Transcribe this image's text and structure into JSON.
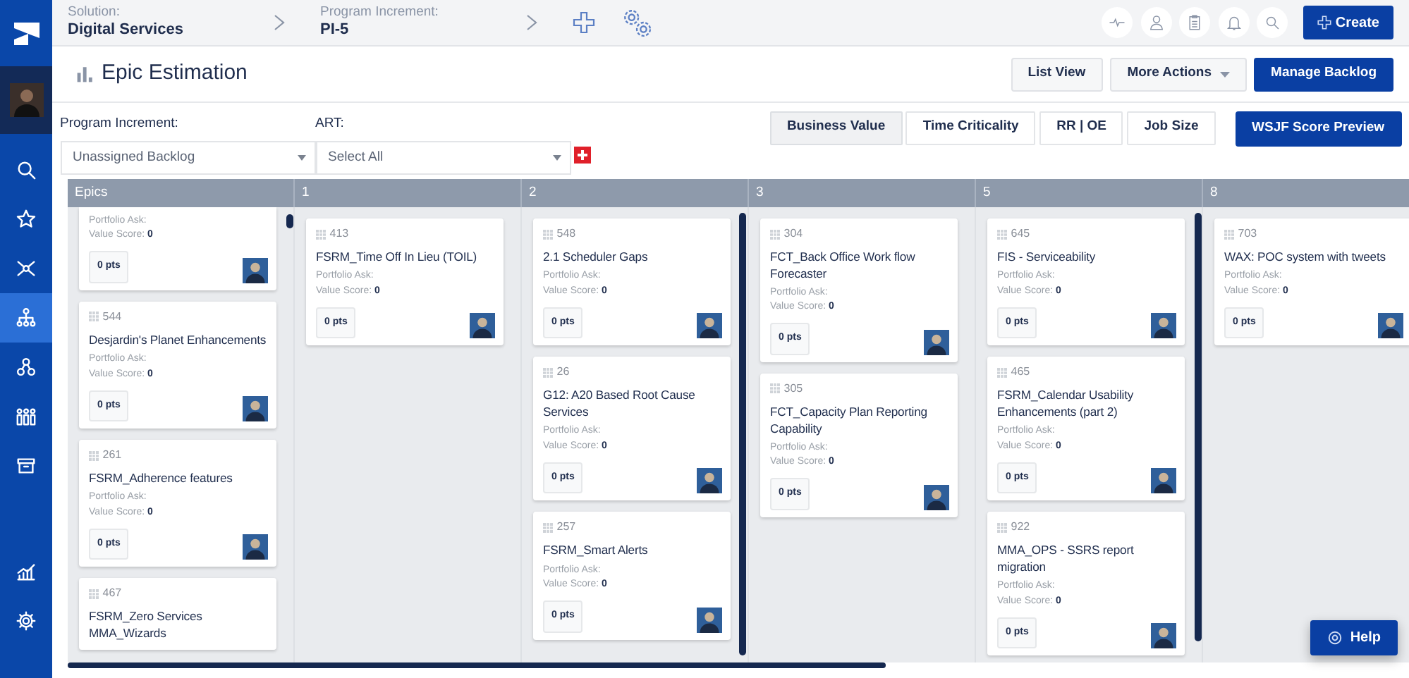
{
  "sidebar": {
    "items": [
      {
        "selected": false
      },
      {
        "selected": false
      },
      {
        "selected": false
      },
      {
        "selected": true
      },
      {
        "selected": false
      },
      {
        "selected": false
      },
      {
        "selected": false
      }
    ],
    "bottom_items": [
      {
        "selected": false
      },
      {
        "selected": false
      }
    ]
  },
  "topbar": {
    "breadcrumbs": [
      {
        "label": "Solution:",
        "value": "Digital Services"
      },
      {
        "label": "Program Increment:",
        "value": "PI-5"
      }
    ],
    "create_button": "Create"
  },
  "page_title": "Epic Estimation",
  "header_buttons": [
    {
      "label": "List View",
      "kind": "default"
    },
    {
      "label": "More Actions",
      "kind": "dropdown"
    },
    {
      "label": "Manage Backlog",
      "kind": "primary"
    }
  ],
  "filters": [
    {
      "label": "Program Increment:",
      "value": "Unassigned Backlog"
    },
    {
      "label": "ART:",
      "value": "Select All"
    }
  ],
  "view_toggles": [
    {
      "label": "Business Value",
      "selected": true
    },
    {
      "label": "Time Criticality",
      "selected": false
    },
    {
      "label": "RR | OE",
      "selected": false
    },
    {
      "label": "Job Size",
      "selected": false
    }
  ],
  "preview_button": "WSJF Score Preview",
  "board": {
    "columns": [
      {
        "title": "Epics",
        "cards": [
          {
            "portfolio_ask": "Portfolio Ask:",
            "value_score": "Value Score: **0**",
            "points": "0 pts"
          },
          {
            "id": "544",
            "title": "Desjardin's Planet Enhancements",
            "portfolio_ask": "Portfolio Ask:",
            "value_score": "Value Score: **0**",
            "points": "0 pts"
          },
          {
            "id": "261",
            "title": "FSRM_Adherence features",
            "portfolio_ask": "Portfolio Ask:",
            "value_score": "Value Score: **0**",
            "points": "0 pts"
          },
          {
            "id": "467",
            "title": "FSRM_Zero Services MMA_Wizards"
          }
        ]
      },
      {
        "title": "1",
        "cards": [
          {
            "id": "413",
            "title": "FSRM_Time Off In Lieu (TOIL)",
            "portfolio_ask": "Portfolio Ask:",
            "value_score": "Value Score: **0**",
            "points": "0 pts"
          }
        ]
      },
      {
        "title": "2",
        "cards": [
          {
            "id": "548",
            "title": "2.1 Scheduler Gaps",
            "portfolio_ask": "Portfolio Ask:",
            "value_score": "Value Score: **0**",
            "points": "0 pts"
          },
          {
            "id": "26",
            "title": "G12: A20 Based Root Cause Services",
            "portfolio_ask": "Portfolio Ask:",
            "value_score": "Value Score: **0**",
            "points": "0 pts"
          },
          {
            "id": "257",
            "title": "FSRM_Smart Alerts",
            "portfolio_ask": "Portfolio Ask:",
            "value_score": "Value Score: **0**",
            "points": "0 pts"
          }
        ]
      },
      {
        "title": "3",
        "cards": [
          {
            "id": "304",
            "title": "FCT_Back Office Work flow Forecaster",
            "portfolio_ask": "Portfolio Ask:",
            "value_score": "Value Score: **0**",
            "points": "0 pts"
          },
          {
            "id": "305",
            "title": "FCT_Capacity Plan Reporting Capability",
            "portfolio_ask": "Portfolio Ask:",
            "value_score": "Value Score: **0**",
            "points": "0 pts"
          }
        ]
      },
      {
        "title": "5",
        "cards": [
          {
            "id": "645",
            "title": "FIS - Serviceability",
            "portfolio_ask": "Portfolio Ask:",
            "value_score": "Value Score: **0**",
            "points": "0 pts"
          },
          {
            "id": "465",
            "title": "FSRM_Calendar Usability Enhancements (part 2)",
            "portfolio_ask": "Portfolio Ask:",
            "value_score": "Value Score: **0**",
            "points": "0 pts"
          },
          {
            "id": "922",
            "title": "MMA_OPS - SSRS report migration",
            "portfolio_ask": "Portfolio Ask:",
            "value_score": "Value Score: **0**",
            "points": "0 pts"
          }
        ]
      },
      {
        "title": "8",
        "cards": [
          {
            "id": "703",
            "title": "WAX: POC system with tweets",
            "portfolio_ask": "Portfolio Ask:",
            "value_score": "Value Score: **0**",
            "points": "0 pts"
          }
        ]
      }
    ]
  },
  "help_button": "Help"
}
